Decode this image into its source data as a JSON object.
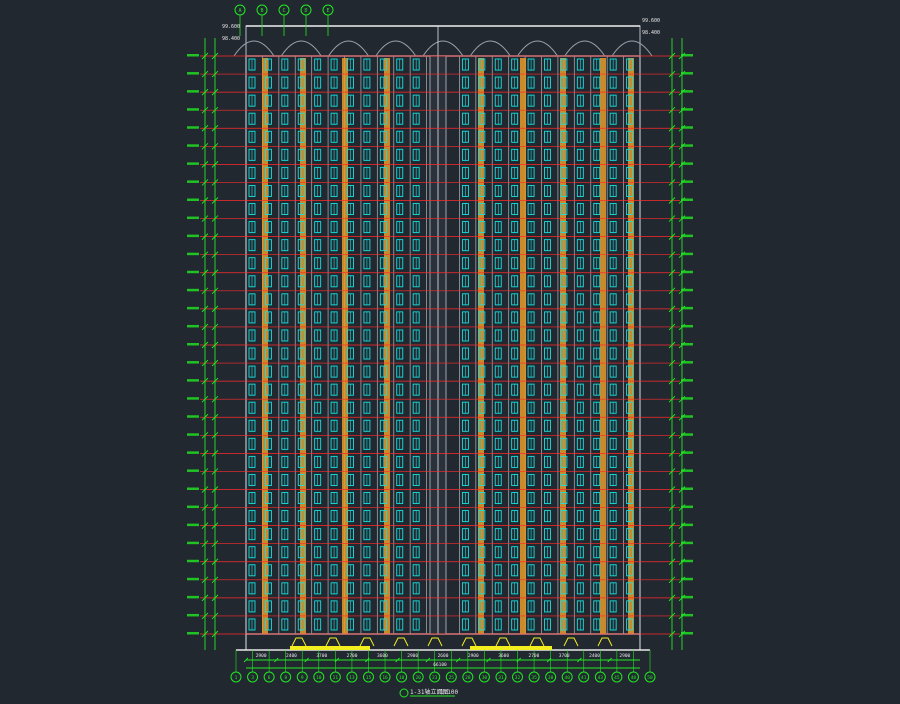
{
  "drawing": {
    "background": "#212830",
    "title": "1-31轴立面图",
    "scale": "1:100",
    "colors": {
      "structure": "#9aa3ad",
      "window": "#18e0e0",
      "floor_line": "#ff2b2b",
      "dimension": "#22e822",
      "stair_strip": "#e89a2a",
      "base": "#f2ee20",
      "white": "#e8e8e8"
    },
    "icons": [
      "axis-bubble-icon",
      "elevation-marker-icon"
    ],
    "floor_count": 32,
    "top_axis_labels": [
      "A",
      "B",
      "C",
      "D",
      "E"
    ],
    "bottom_axis_labels": [
      "1",
      "3",
      "6",
      "8",
      "9",
      "10",
      "11",
      "13",
      "15",
      "16",
      "18",
      "20",
      "23",
      "25",
      "28",
      "30",
      "31",
      "32",
      "35",
      "38",
      "40",
      "41",
      "43",
      "45",
      "48",
      "50"
    ],
    "top_elevation_labels": [
      "99.600",
      "98.400"
    ],
    "bottom_dimension_labels": [
      "2900",
      "2400",
      "3700",
      "2700",
      "3600",
      "2900",
      "2600",
      "2900",
      "3600",
      "2700",
      "3700",
      "2400",
      "2900"
    ],
    "total_dimension_label": "66100"
  }
}
